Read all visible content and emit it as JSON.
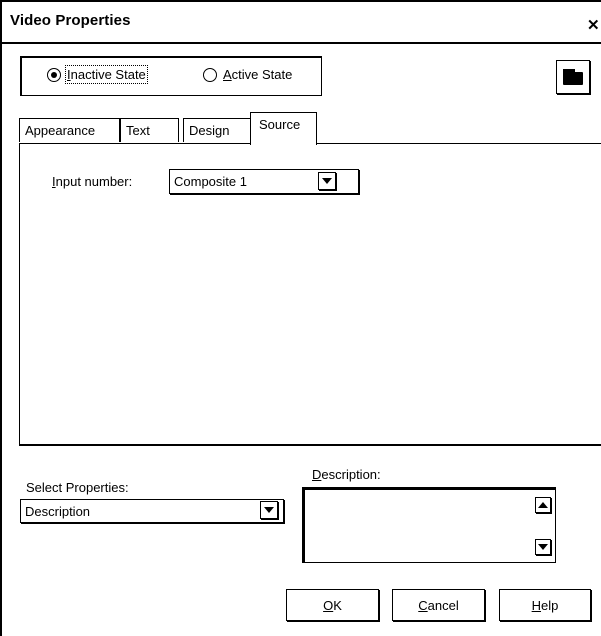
{
  "window": {
    "title": "Video Properties",
    "close_glyph": "✕"
  },
  "state": {
    "inactive_prefix": "",
    "inactive_mnemonic": "I",
    "inactive_rest": "nactive State",
    "active_mnemonic": "A",
    "active_rest": "ctive State",
    "selected": "inactive"
  },
  "folder_button": {
    "icon": "folder-icon"
  },
  "tabs": [
    {
      "label": "Appearance"
    },
    {
      "label": "Text"
    },
    {
      "label": "Design"
    },
    {
      "label": "Source",
      "active": true
    }
  ],
  "source_panel": {
    "input_label_mnemonic": "I",
    "input_label_rest": "nput number:",
    "input_value": "Composite 1"
  },
  "select_properties": {
    "label": "Select Properties:",
    "value": "Description"
  },
  "description": {
    "label_mnemonic": "D",
    "label_rest": "escription:",
    "value": ""
  },
  "buttons": {
    "ok_mnemonic": "O",
    "ok_rest": "K",
    "cancel_mnemonic": "C",
    "cancel_rest": "ancel",
    "help_mnemonic": "H",
    "help_rest": "elp"
  }
}
